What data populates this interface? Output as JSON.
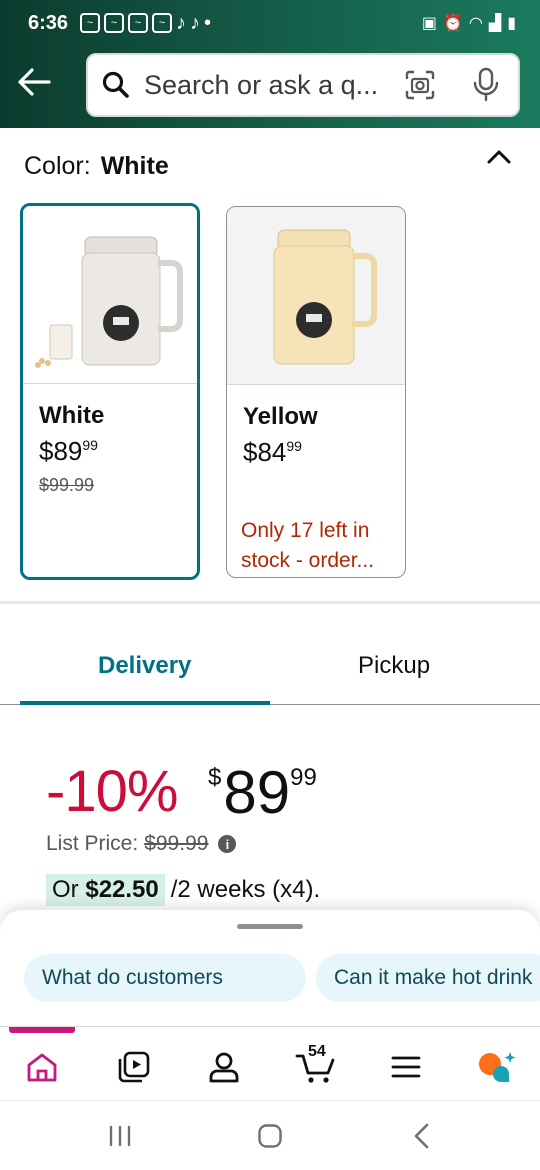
{
  "status_bar": {
    "time": "6:36"
  },
  "search": {
    "placeholder": "Search or ask a q..."
  },
  "color_section": {
    "label": "Color:",
    "selected": "White"
  },
  "options": [
    {
      "name": "White",
      "price_dollars": "$89",
      "price_cents": "99",
      "list_price": "$99.99",
      "stock_note": ""
    },
    {
      "name": "Yellow",
      "price_dollars": "$84",
      "price_cents": "99",
      "list_price": "",
      "stock_note": "Only 17 left in stock - order..."
    }
  ],
  "tabs": {
    "delivery": "Delivery",
    "pickup": "Pickup"
  },
  "price": {
    "discount": "-10%",
    "currency": "$",
    "dollars": "89",
    "cents": "99",
    "list_label": "List Price:",
    "list_value": "$99.99",
    "installment_or": "Or",
    "installment_amount": "$22.50",
    "installment_rest": "/2 weeks (x4)."
  },
  "suggestions": [
    "What do customers",
    "Can it make hot drink"
  ],
  "cart_count": "54",
  "colors": {
    "teal": "#007185",
    "deal_red": "#cc0c39",
    "stock_red": "#b12704",
    "header_green": "#15604a"
  }
}
